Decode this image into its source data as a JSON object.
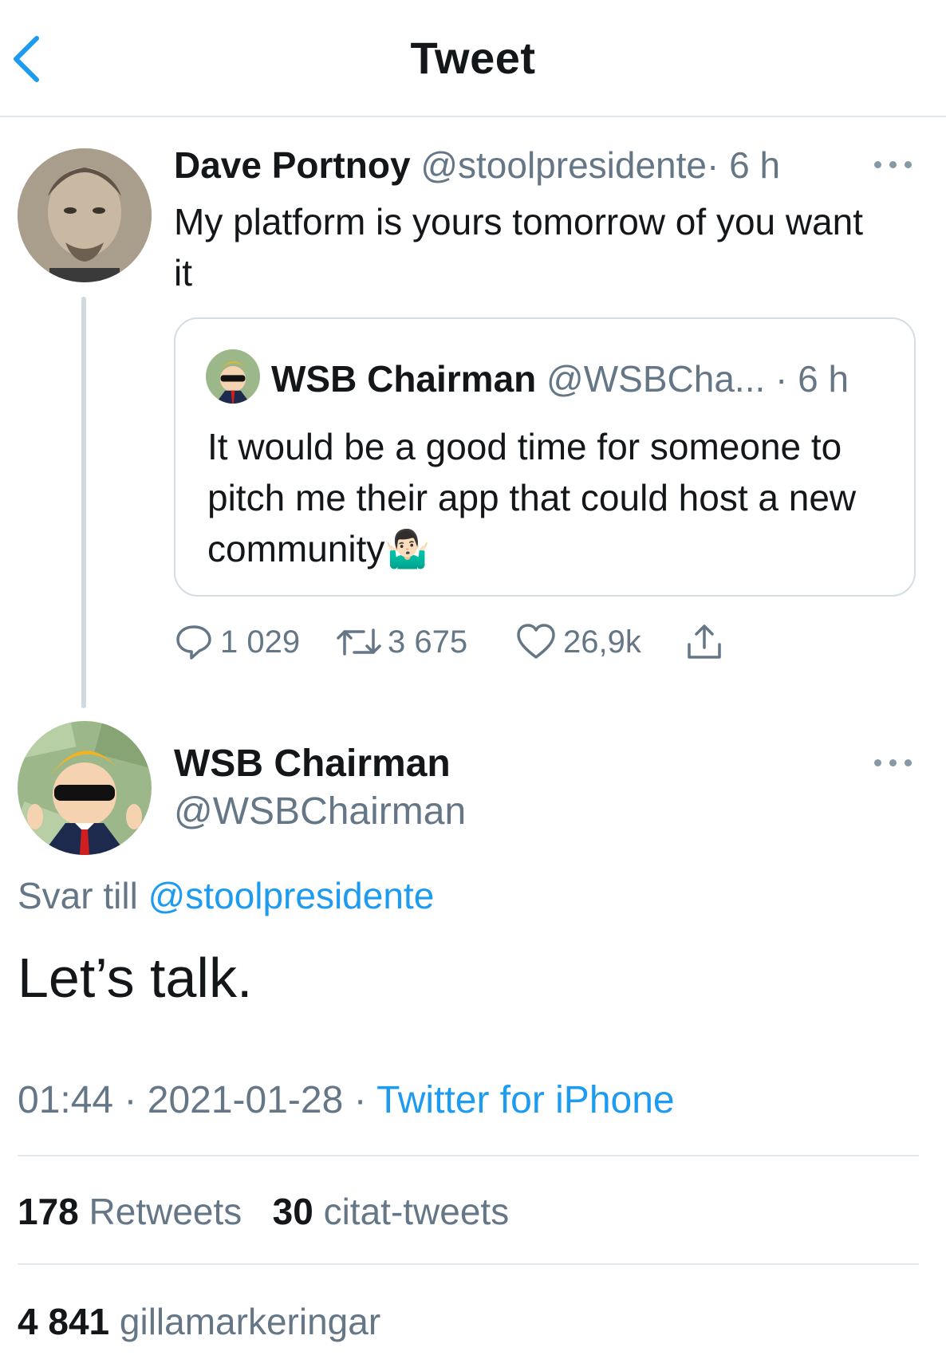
{
  "nav": {
    "title": "Tweet",
    "back_icon": "chevron-left-icon"
  },
  "parent_tweet": {
    "author_name": "Dave Portnoy",
    "handle": "@stoolpresidente",
    "time": "· 6 h",
    "text": "My platform is yours tomorrow of you want it",
    "quoted": {
      "author_name": "WSB Chairman",
      "handle": "@WSBCha...",
      "time": "· 6 h",
      "text": "It would be a good time for someone to pitch me their app that could host a new community",
      "emoji": "🤷🏻‍♂️"
    },
    "actions": {
      "replies": "1 029",
      "retweets": "3 675",
      "likes": "26,9k"
    }
  },
  "main_tweet": {
    "author_name": "WSB Chairman",
    "handle": "@WSBChairman",
    "reply_prefix": "Svar till",
    "reply_to": "@stoolpresidente",
    "text": "Let’s talk.",
    "timestamp": "01:44 · 2021-01-28 ·",
    "source": "Twitter for iPhone",
    "retweets_count": "178",
    "retweets_label": "Retweets",
    "quotes_count": "30",
    "quotes_label": "citat-tweets",
    "likes_count": "4 841",
    "likes_label": "gillamarkeringar"
  },
  "colors": {
    "accent": "#1d9bf0",
    "muted": "#657786",
    "text": "#14171a",
    "divider": "#e1e8ed"
  }
}
